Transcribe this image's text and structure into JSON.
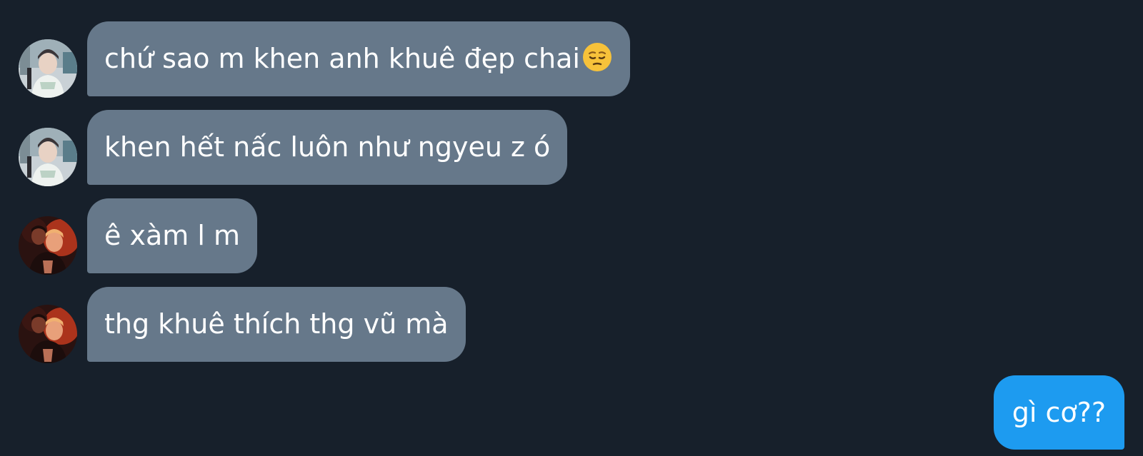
{
  "messages": [
    {
      "text": "chứ sao m khen anh khuê đẹp chai",
      "emoji": "pensive-face-emoji"
    },
    {
      "text": "khen hết nấc luôn như ngyeu z ó"
    },
    {
      "text": "ê xàm l m"
    },
    {
      "text": "thg khuê thích thg vũ mà"
    }
  ],
  "outgoing": {
    "text": "gì cơ??"
  },
  "colors": {
    "background": "#17202b",
    "incoming_bubble": "#66788a",
    "outgoing_bubble": "#1d9bf0",
    "text": "#ffffff"
  }
}
